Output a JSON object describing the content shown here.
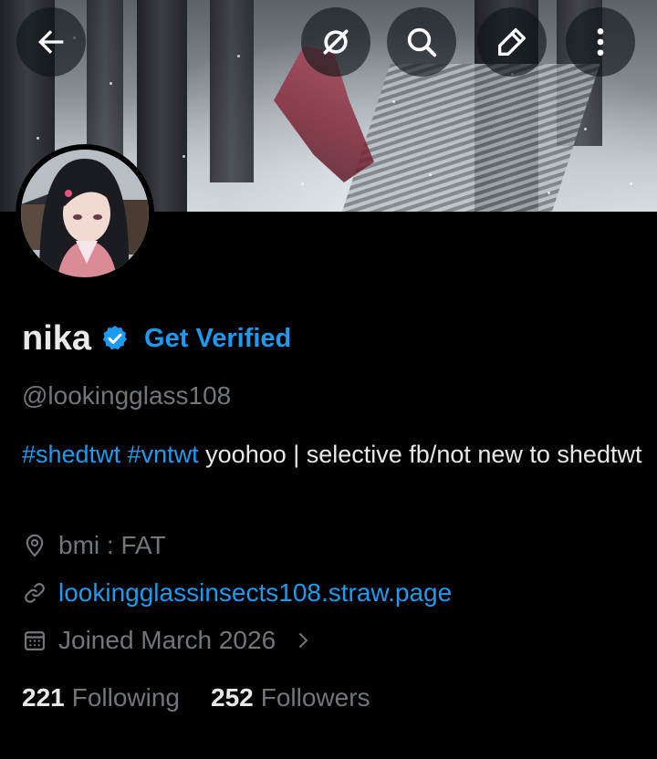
{
  "header": {
    "back_icon": "arrow-left-icon",
    "grok_icon": "grok-icon",
    "search_icon": "search-icon",
    "edit_icon": "edit-pencil-icon",
    "more_icon": "more-vertical-icon"
  },
  "profile": {
    "name": "nika",
    "get_verified": "Get Verified",
    "handle": "@lookingglass108",
    "bio_tag1": "#shedtwt",
    "bio_tag2": "#vntwt",
    "bio_text": "yoohoo | selective fb/not new to shedtwt",
    "location": "bmi : FAT",
    "website": "lookingglassinsects108.straw.page",
    "joined": "Joined March 2026",
    "following_count": "221",
    "following_label": "Following",
    "followers_count": "252",
    "followers_label": "Followers"
  },
  "colors": {
    "accent": "#1d9bf0",
    "muted": "#71767b",
    "text": "#e7e9ea",
    "background": "#000000"
  }
}
